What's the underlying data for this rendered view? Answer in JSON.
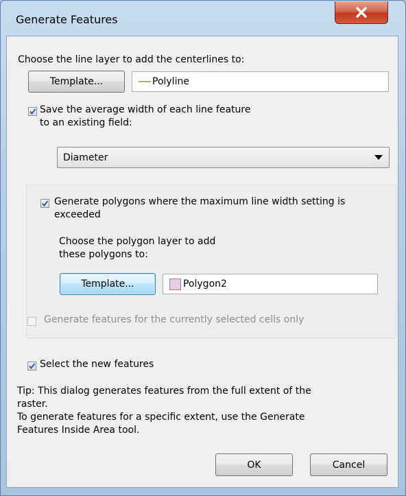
{
  "window": {
    "title": "Generate Features",
    "close_glyph": "X"
  },
  "line_layer": {
    "prompt": "Choose the line layer to add the centerlines to:",
    "template_button": "Template...",
    "layer_name": "Polyline",
    "layer_color": "#b5b04a"
  },
  "width": {
    "checked": true,
    "label_line1": "Save the average width of each line feature",
    "label_line2": "to an existing field:",
    "field_selected": "Diameter"
  },
  "polygons": {
    "checked": true,
    "label_line1": "Generate polygons where the maximum line width setting is",
    "label_line2": "exceeded",
    "prompt_line1": "Choose the polygon layer to add",
    "prompt_line2": "these polygons to:",
    "template_button": "Template...",
    "layer_name": "Polygon2",
    "layer_color": "#eacbe6"
  },
  "selected_cells": {
    "checked": false,
    "enabled": false,
    "label": "Generate features for the currently selected cells only"
  },
  "select_new": {
    "checked": true,
    "label": "Select the new features"
  },
  "tip": {
    "line1": "Tip:  This dialog generates features from the full extent of the",
    "line2": "raster.",
    "line3": "To generate features for a specific extent, use the Generate",
    "line4": "Features Inside Area tool."
  },
  "buttons": {
    "ok": "OK",
    "cancel": "Cancel"
  }
}
